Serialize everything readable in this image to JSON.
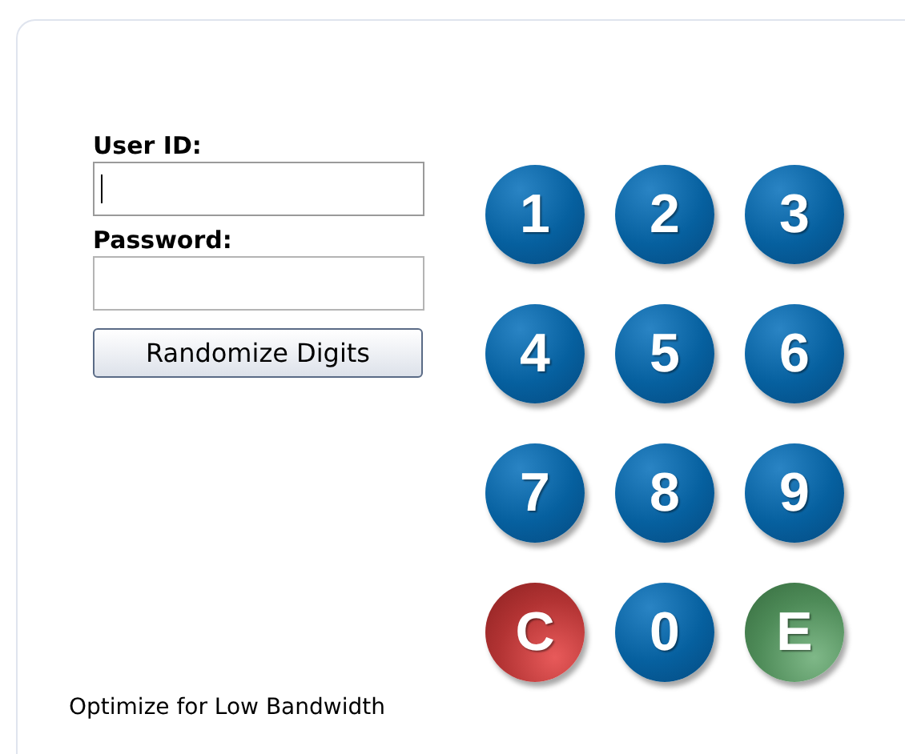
{
  "login": {
    "fields": [
      {
        "label": "User ID:",
        "focused": true
      },
      {
        "label": "Password:",
        "focused": false
      }
    ],
    "button": "Randomize Digits"
  },
  "keypad": [
    {
      "label": "1",
      "kind": "digit"
    },
    {
      "label": "2",
      "kind": "digit"
    },
    {
      "label": "3",
      "kind": "digit"
    },
    {
      "label": "4",
      "kind": "digit"
    },
    {
      "label": "5",
      "kind": "digit"
    },
    {
      "label": "6",
      "kind": "digit"
    },
    {
      "label": "7",
      "kind": "digit"
    },
    {
      "label": "8",
      "kind": "digit"
    },
    {
      "label": "9",
      "kind": "digit"
    },
    {
      "label": "C",
      "kind": "clear"
    },
    {
      "label": "0",
      "kind": "digit"
    },
    {
      "label": "E",
      "kind": "enter"
    }
  ],
  "footer": "Optimize for Low Bandwidth"
}
